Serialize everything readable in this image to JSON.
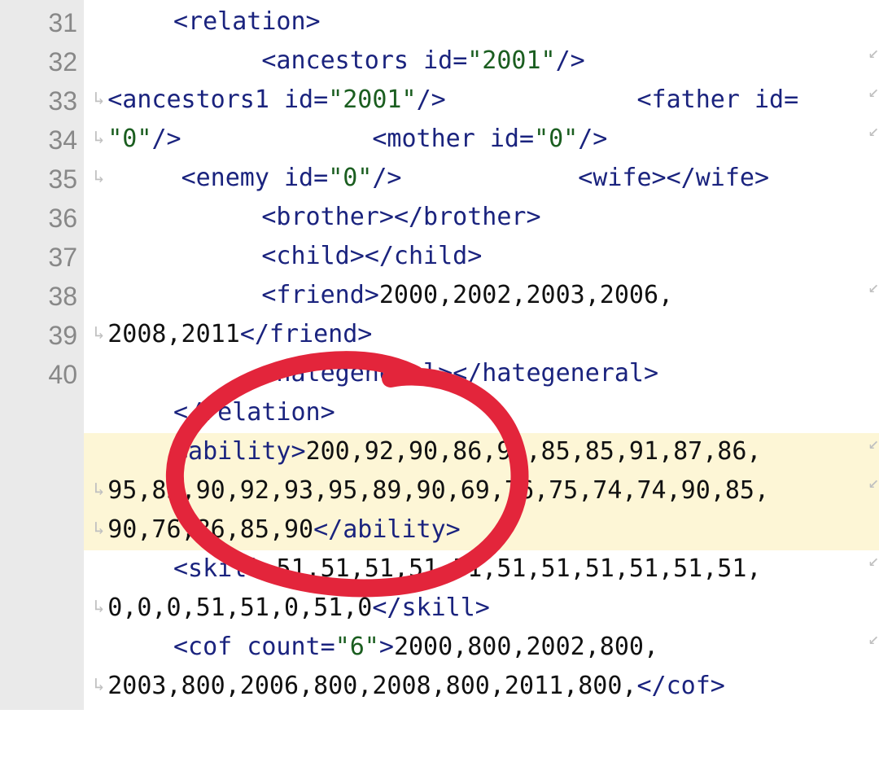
{
  "gutter": [
    "31",
    "32",
    "",
    "",
    "",
    "33",
    "34",
    "35",
    "",
    "36",
    "37",
    "38",
    "",
    "",
    "39",
    "",
    "40",
    ""
  ],
  "lines": {
    "l31": {
      "open_relation": "<relation>"
    },
    "l32": {
      "ancestors_open": "<ancestors",
      "ancestors_attr": "id",
      "ancestors_val": "\"2001\"",
      "ancestors_close": "/>",
      "ancestors1_open": "<ancestors1",
      "ancestors1_attr": "id",
      "ancestors1_val": "\"2001\"",
      "ancestors1_close": "/>",
      "father_open": "<father",
      "father_attr": "id",
      "father_eq": "=",
      "father_val": "\"0\"",
      "father_close": "/>",
      "mother_open": "<mother",
      "mother_attr": "id",
      "mother_val": "\"0\"",
      "mother_close": "/>",
      "enemy_open": "<enemy",
      "enemy_attr": "id",
      "enemy_val": "\"0\"",
      "enemy_close": "/>",
      "wife_open": "<wife>",
      "wife_close": "</wife>"
    },
    "l33": {
      "brother_open": "<brother>",
      "brother_close": "</brother>"
    },
    "l34": {
      "child_open": "<child>",
      "child_close": "</child>"
    },
    "l35": {
      "friend_open": "<friend>",
      "friend_txt_a": "2000,2002,2003,2006,",
      "friend_txt_b": "2008,2011",
      "friend_close": "</friend>"
    },
    "l36": {
      "hate_open": "<hategeneral>",
      "hate_close": "</hategeneral>"
    },
    "l37": {
      "relation_close": "</relation>"
    },
    "l38": {
      "ability_open": "<ability>",
      "ability_txt_a": "200,92,90,86,91,85,85,91,87,86,",
      "ability_txt_b": "95,83,90,92,93,95,89,90,69,76,75,74,74,90,85,",
      "ability_txt_c": "90,76,86,85,90",
      "ability_close": "</ability>"
    },
    "l39": {
      "skill_open": "<skill>",
      "skill_txt_a": "51,51,51,51,51,51,51,51,51,51,51,",
      "skill_txt_b": "0,0,0,51,51,0,51,0",
      "skill_close": "</skill>"
    },
    "l40": {
      "cof_open": "<cof",
      "cof_attr": "count",
      "cof_val": "\"6\"",
      "cof_gt": ">",
      "cof_txt_a": "2000,800,2002,800,",
      "cof_txt_b": "2003,800,2006,800,2008,800,2011,800,",
      "cof_close": "</cof>"
    }
  },
  "glyphs": {
    "wrap_end": "↙",
    "wrap_start": "↳"
  }
}
